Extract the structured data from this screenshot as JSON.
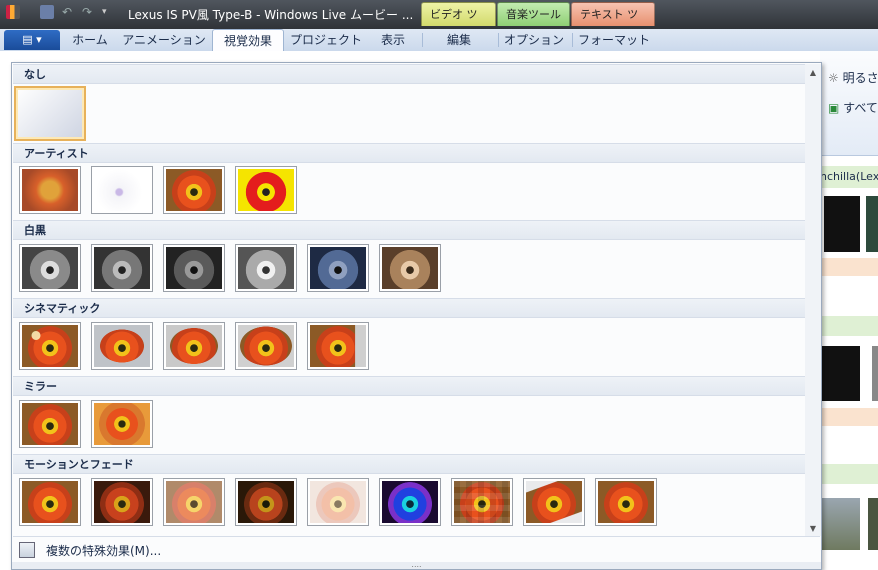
{
  "window": {
    "title": "Lexus IS PV風 Type-B - Windows Live ムービー ...",
    "context_tabs": [
      {
        "label": "ビデオ ツール",
        "color": "#e4ec87"
      },
      {
        "label": "音楽ツール",
        "color": "#a6dc8c"
      },
      {
        "label": "テキスト ツール",
        "color": "#f1a98f"
      }
    ]
  },
  "ribbon": {
    "tabs": [
      "ホーム",
      "アニメーション",
      "視覚効果",
      "プロジェクト",
      "表示",
      "編集",
      "オプション",
      "フォーマット"
    ],
    "active_tab": "視覚効果",
    "right_items": [
      "明るさ",
      "すべて("
    ]
  },
  "storyboard": {
    "clip_label": "nchilla(Lex"
  },
  "gallery": {
    "categories": [
      {
        "label": "なし",
        "items": [
          {
            "effect": "none"
          }
        ]
      },
      {
        "label": "アーティスト",
        "items": [
          {
            "effect": "artist-1"
          },
          {
            "effect": "artist-2"
          },
          {
            "effect": "artist-3"
          },
          {
            "effect": "artist-4"
          }
        ]
      },
      {
        "label": "白黒",
        "items": [
          {
            "effect": "bw-1"
          },
          {
            "effect": "bw-2"
          },
          {
            "effect": "bw-3"
          },
          {
            "effect": "bw-4"
          },
          {
            "effect": "bw-cyan"
          },
          {
            "effect": "bw-sepia"
          }
        ]
      },
      {
        "label": "シネマティック",
        "items": [
          {
            "effect": "cine-1"
          },
          {
            "effect": "cine-2"
          },
          {
            "effect": "cine-3"
          },
          {
            "effect": "cine-4"
          },
          {
            "effect": "cine-5"
          }
        ]
      },
      {
        "label": "ミラー",
        "items": [
          {
            "effect": "mirror-1"
          },
          {
            "effect": "mirror-2"
          }
        ]
      },
      {
        "label": "モーションとフェード",
        "items": [
          {
            "effect": "mf-1"
          },
          {
            "effect": "mf-2"
          },
          {
            "effect": "mf-3"
          },
          {
            "effect": "mf-4"
          },
          {
            "effect": "mf-5"
          },
          {
            "effect": "mf-6"
          },
          {
            "effect": "mf-7"
          },
          {
            "effect": "mf-8"
          },
          {
            "effect": "mf-9"
          }
        ]
      }
    ],
    "selected": "none",
    "footer_label": "複数の特殊効果(M)...",
    "grip": "...."
  }
}
